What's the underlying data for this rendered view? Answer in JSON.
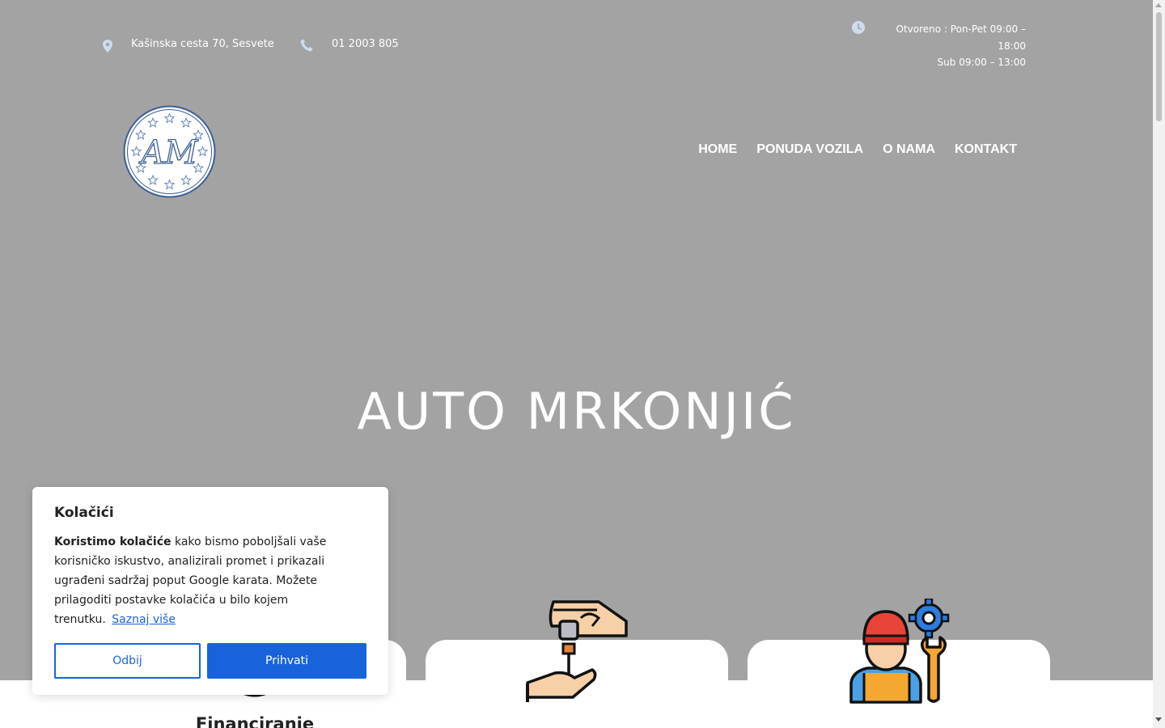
{
  "topbar": {
    "address": "Kašinska cesta 70, Sesvete",
    "phone": "01 2003 805",
    "hours_line1": "Otvoreno : Pon-Pet 09:00 –",
    "hours_line2": "18:00",
    "hours_line3": "Sub 09:00 – 13:00",
    "icons": [
      "map-pin-icon",
      "phone-icon",
      "clock-icon"
    ],
    "icon_color": "#cfdcf0"
  },
  "logo": {
    "monogram": "AM"
  },
  "nav": {
    "items": [
      {
        "label": "HOME"
      },
      {
        "label": "PONUDA VOZILA"
      },
      {
        "label": "O NAMA"
      },
      {
        "label": "KONTAKT"
      }
    ]
  },
  "hero": {
    "title": "AUTO MRKONJIĆ",
    "background": "#a3a3a3"
  },
  "cards": [
    {
      "title": "Financiranje",
      "icon": "financing-icon"
    },
    {
      "title": "",
      "icon": "key-handover-icon"
    },
    {
      "title": "",
      "icon": "mechanic-icon"
    }
  ],
  "cookie": {
    "title": "Kolačići",
    "text_bold": "Koristimo kolačiće",
    "text_rest": "kako bismo poboljšali vaše korisničko iskustvo, analizirali promet i prikazali ugrađeni sadržaj poput Google karata. Možete prilagoditi postavke kolačića u bilo kojem trenutku.",
    "link": "Saznaj više",
    "reject_label": "Odbij",
    "accept_label": "Prihvati",
    "accent": "#1863dc"
  }
}
